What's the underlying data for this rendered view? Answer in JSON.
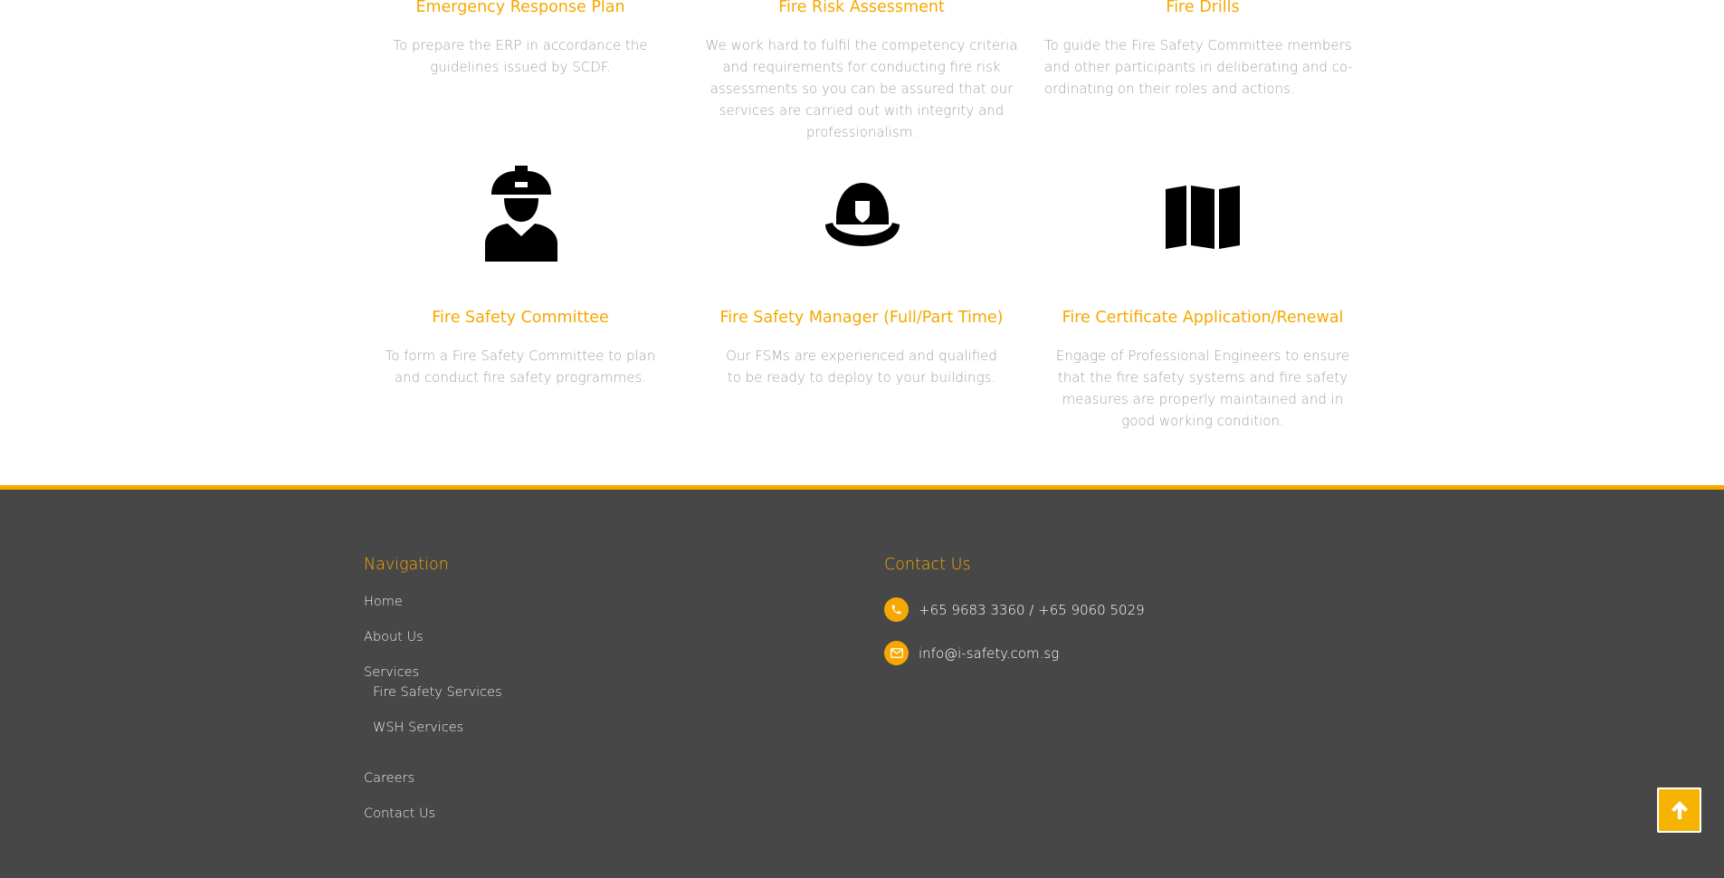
{
  "services": [
    {
      "title": "Emergency Response Plan",
      "description": "To prepare the ERP in accordance the guidelines issued by SCDF."
    },
    {
      "title": "Fire Risk Assessment",
      "description": "We work hard to fulfil the competency criteria and requirements for conducting fire risk assessments so you can be assured that our services are carried out with integrity and professionalism."
    },
    {
      "title": "Fire Drills",
      "description": "To guide the Fire Safety Committee members and other participants in deliberating and co-ordinating on their roles and actions."
    },
    {
      "title": "Fire Safety Committee",
      "description": "To form a Fire Safety Committee to plan and conduct fire safety programmes.",
      "icon": "worker-helmet-icon"
    },
    {
      "title": "Fire Safety Manager (Full/Part Time)",
      "description": "Our FSMs are experienced and qualified to be ready to deploy  to your buildings.",
      "icon": "fire-helmet-icon"
    },
    {
      "title": "Fire Certificate Application/Renewal",
      "description": "Engage of Professional Engineers to ensure that the fire safety systems and fire safety measures are properly maintained and in good working condition.",
      "icon": "map-icon"
    }
  ],
  "footer": {
    "navigation": {
      "heading": "Navigation",
      "items": [
        "Home",
        "About Us",
        "Services",
        "Fire Safety Services",
        "WSH Services",
        "Careers",
        "Contact Us"
      ]
    },
    "contact": {
      "heading": "Contact Us",
      "phone": "+65 9683 3360 / +65 9060 5029",
      "email": "info@i-safety.com.sg"
    }
  },
  "colors": {
    "accent": "#f6a800",
    "footer_bg": "#474747",
    "text_muted": "#a3a3a3"
  },
  "back_to_top_icon": "arrow-up-icon"
}
